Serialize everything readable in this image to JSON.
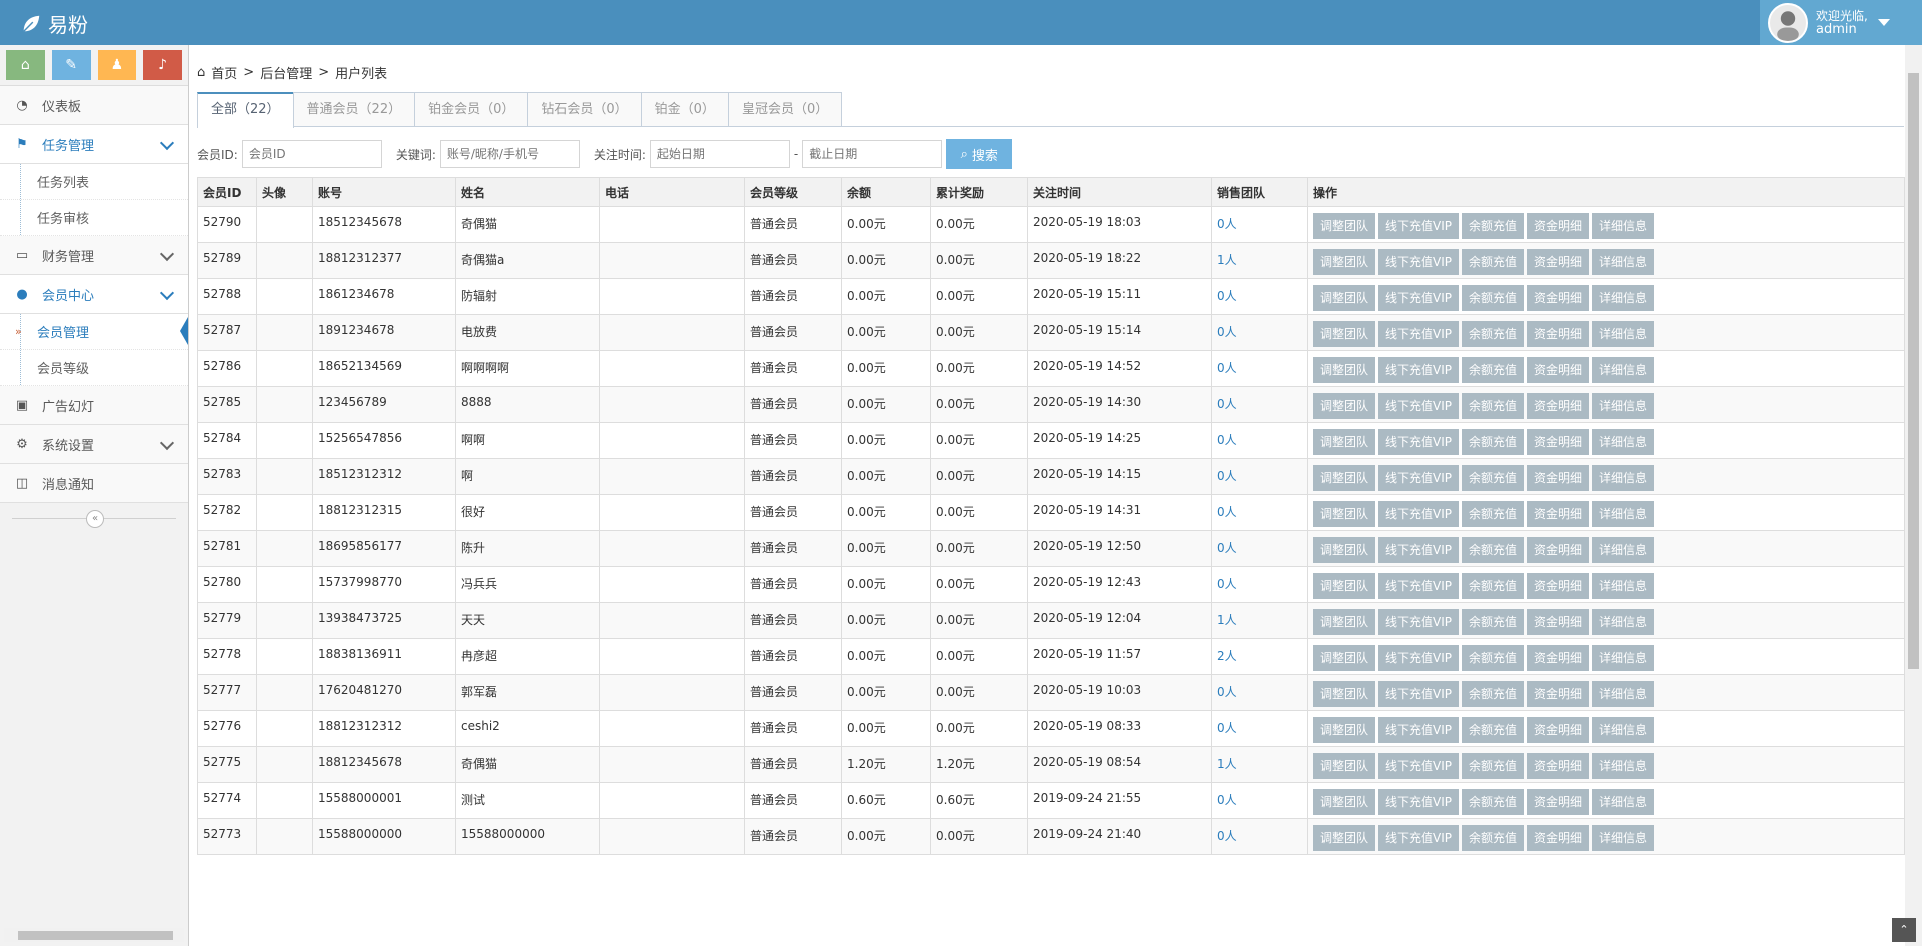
{
  "app": {
    "title": "易粉"
  },
  "user": {
    "welcome": "欢迎光临,",
    "name": "admin"
  },
  "sidebar": {
    "items": [
      {
        "label": "仪表板"
      },
      {
        "label": "任务管理",
        "sub": [
          "任务列表",
          "任务审核"
        ]
      },
      {
        "label": "财务管理"
      },
      {
        "label": "会员中心",
        "sub": [
          "会员管理",
          "会员等级"
        ]
      },
      {
        "label": "广告幻灯"
      },
      {
        "label": "系统设置"
      },
      {
        "label": "消息通知"
      }
    ],
    "collapse_glyph": "«"
  },
  "breadcrumb": {
    "home": "首页",
    "sep": ">",
    "level1": "后台管理",
    "level2": "用户列表"
  },
  "tabs": [
    "全部（22）",
    "普通会员（22）",
    "铂金会员（0）",
    "钻石会员（0）",
    "铂金（0）",
    "皇冠会员（0）"
  ],
  "filters": {
    "member_id_label": "会员ID:",
    "member_id_placeholder": "会员ID",
    "keyword_label": "关键词:",
    "keyword_placeholder": "账号/昵称/手机号",
    "time_label": "关注时间:",
    "start_placeholder": "起始日期",
    "dash": "-",
    "end_placeholder": "截止日期",
    "search_label": "搜索"
  },
  "table": {
    "headers": [
      "会员ID",
      "头像",
      "账号",
      "姓名",
      "电话",
      "会员等级",
      "余额",
      "累计奖励",
      "关注时间",
      "销售团队",
      "操作"
    ],
    "actions": [
      "调整团队",
      "线下充值VIP",
      "余额充值",
      "资金明细",
      "详细信息"
    ],
    "rows": [
      [
        "52790",
        "",
        "18512345678",
        "奇偶猫",
        "",
        "普通会员",
        "0.00元",
        "0.00元",
        "2020-05-19 18:03",
        "0人"
      ],
      [
        "52789",
        "",
        "18812312377",
        "奇偶猫a",
        "",
        "普通会员",
        "0.00元",
        "0.00元",
        "2020-05-19 18:22",
        "1人"
      ],
      [
        "52788",
        "",
        "1861234678",
        "防辐射",
        "",
        "普通会员",
        "0.00元",
        "0.00元",
        "2020-05-19 15:11",
        "0人"
      ],
      [
        "52787",
        "",
        "1891234678",
        "电放费",
        "",
        "普通会员",
        "0.00元",
        "0.00元",
        "2020-05-19 15:14",
        "0人"
      ],
      [
        "52786",
        "",
        "18652134569",
        "啊啊啊啊",
        "",
        "普通会员",
        "0.00元",
        "0.00元",
        "2020-05-19 14:52",
        "0人"
      ],
      [
        "52785",
        "",
        "123456789",
        "8888",
        "",
        "普通会员",
        "0.00元",
        "0.00元",
        "2020-05-19 14:30",
        "0人"
      ],
      [
        "52784",
        "",
        "15256547856",
        "啊啊",
        "",
        "普通会员",
        "0.00元",
        "0.00元",
        "2020-05-19 14:25",
        "0人"
      ],
      [
        "52783",
        "",
        "18512312312",
        "啊",
        "",
        "普通会员",
        "0.00元",
        "0.00元",
        "2020-05-19 14:15",
        "0人"
      ],
      [
        "52782",
        "",
        "18812312315",
        "很好",
        "",
        "普通会员",
        "0.00元",
        "0.00元",
        "2020-05-19 14:31",
        "0人"
      ],
      [
        "52781",
        "",
        "18695856177",
        "陈升",
        "",
        "普通会员",
        "0.00元",
        "0.00元",
        "2020-05-19 12:50",
        "0人"
      ],
      [
        "52780",
        "",
        "15737998770",
        "冯兵兵",
        "",
        "普通会员",
        "0.00元",
        "0.00元",
        "2020-05-19 12:43",
        "0人"
      ],
      [
        "52779",
        "",
        "13938473725",
        "天天",
        "",
        "普通会员",
        "0.00元",
        "0.00元",
        "2020-05-19 12:04",
        "1人"
      ],
      [
        "52778",
        "",
        "18838136911",
        "冉彦超",
        "",
        "普通会员",
        "0.00元",
        "0.00元",
        "2020-05-19 11:57",
        "2人"
      ],
      [
        "52777",
        "",
        "17620481270",
        "郭军磊",
        "",
        "普通会员",
        "0.00元",
        "0.00元",
        "2020-05-19 10:03",
        "0人"
      ],
      [
        "52776",
        "",
        "18812312312",
        "ceshi2",
        "",
        "普通会员",
        "0.00元",
        "0.00元",
        "2020-05-19 08:33",
        "0人"
      ],
      [
        "52775",
        "",
        "18812345678",
        "奇偶猫",
        "",
        "普通会员",
        "1.20元",
        "1.20元",
        "2020-05-19 08:54",
        "1人"
      ],
      [
        "52774",
        "",
        "15588000001",
        "测试",
        "",
        "普通会员",
        "0.60元",
        "0.60元",
        "2019-09-24 21:55",
        "0人"
      ],
      [
        "52773",
        "",
        "15588000000",
        "15588000000",
        "",
        "普通会员",
        "0.00元",
        "0.00元",
        "2019-09-24 21:40",
        "0人"
      ]
    ]
  },
  "colors": {
    "topbar": "#4a8fbd",
    "accent": "#2b7dbc",
    "action_button": "#abbac3",
    "search_button": "#6fb3e0"
  }
}
